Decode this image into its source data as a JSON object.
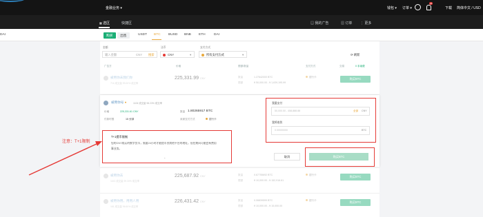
{
  "header": {
    "nav_finance": "金融业务",
    "wallet": "钱包",
    "orders": "订单",
    "notif_badge": "24",
    "download": "下载",
    "language": "简体中文 / USD"
  },
  "subnav": {
    "tab_select": "选区",
    "tab_quick": "快捷区",
    "my_ads": "我的广告",
    "orders": "订单",
    "more": "更多"
  },
  "left_edge_label": "DAI",
  "tabs": {
    "buy": "购买",
    "sell": "出售",
    "coins": [
      "USDT",
      "BTC",
      "BUSD",
      "BNB",
      "ETH",
      "DAI"
    ],
    "active_coin": "BTC"
  },
  "filters": {
    "amount_label": "金额",
    "amount_placeholder": "输入金额",
    "amount_unit": "CNY",
    "amount_search": "搜索",
    "fiat_label": "法币",
    "fiat_value": "CNY",
    "pay_label": "支付方式",
    "pay_value": "所有支付方式",
    "refresh": "刷新"
  },
  "table_headers": {
    "advertiser": "广告方",
    "price": "价格",
    "limit": "限额/数量",
    "payment": "支付方式",
    "trade": "交易",
    "fee": "0 手续费"
  },
  "rows": [
    {
      "name": "被用你未我们你",
      "sub": "716 成交量  99.00% 成交率",
      "price": "225,331.99",
      "price_unit": "CNY",
      "qty_label": "数量",
      "qty": "1.27642000 BTC",
      "limit_label": "限额",
      "limit": "¥ 50,000.00 - ¥ 1,639,195.99",
      "payment": "银行卡",
      "action": "购买BTC"
    },
    {
      "name": "被用你去",
      "sub": "1161 成交量  99.30% 成交率",
      "price": "225,687.92",
      "price_unit": "CNY",
      "qty_label": "数量",
      "qty": "0.67755692 BTC",
      "limit_label": "限额",
      "limit": "¥ 10,000.00 - ¥ 152,916.61",
      "payment": "银行卡",
      "action": "购买BTC"
    },
    {
      "name": "被用你用，用用人用",
      "sub": "161 成交量  96.60% 成交率",
      "price": "226,431.42",
      "price_unit": "CNY",
      "qty_label": "数量",
      "qty": "0.06839599 BTC",
      "limit_label": "限额",
      "limit": "¥ 10,000.00 - ¥ 15,000.00",
      "payment": "银行卡",
      "action": "购买BTC"
    }
  ],
  "expanded": {
    "name": "被用你号",
    "stats": "1106 成交量  98.23% 成交率",
    "price_label": "价格",
    "price": "225,331.61 CNY",
    "avail_label": "数量",
    "avail": "1.80265917 BTC",
    "time_label": "付款时限",
    "time_value": "15 分钟",
    "pay_label": "卖家支付方式",
    "pay_value": "银行卡",
    "tip_title": "T+1提币限制",
    "tip_body": "您的CNY购买的数字货币，需要24小时才能提币到其他平台的地址，但在期间可能会有费用",
    "tip_body_2": "事业务。",
    "pay_field_label": "我要支付",
    "pay_field_placeholder": "50,000.00 - 458,888.88",
    "pay_field_all": "全部",
    "pay_field_unit": "CNY",
    "recv_field_label": "我将收到",
    "recv_field_placeholder": "0.00000000",
    "recv_field_unit": "BTC",
    "cancel": "取消",
    "buy": "购买BTC"
  },
  "annotation": {
    "text": "注意：T+1限制",
    "color": "#e53935"
  },
  "colors": {
    "green": "#1aae75",
    "topbar": "#141414",
    "red_annotation": "#e53935"
  }
}
